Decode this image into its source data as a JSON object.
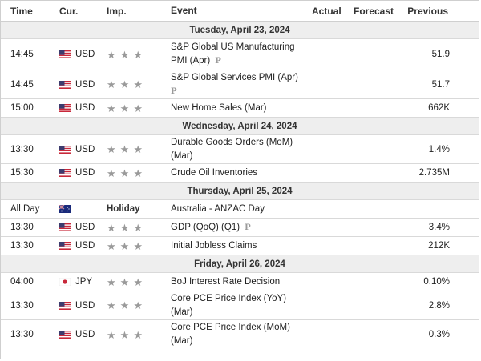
{
  "headers": {
    "time": "Time",
    "currency": "Cur.",
    "importance": "Imp.",
    "event": "Event",
    "actual": "Actual",
    "forecast": "Forecast",
    "previous": "Previous"
  },
  "dates": {
    "d0": "Tuesday, April 23, 2024",
    "d1": "Wednesday, April 24, 2024",
    "d2": "Thursday, April 25, 2024",
    "d3": "Friday, April 26, 2024"
  },
  "events": [
    {
      "time": "14:45",
      "currency": "USD",
      "flag": "us-flag",
      "stars": 3,
      "event": "S&P Global US Manufacturing PMI (Apr)",
      "preliminary": "P",
      "actual": "",
      "forecast": "",
      "previous": "51.9"
    },
    {
      "time": "14:45",
      "currency": "USD",
      "flag": "us-flag",
      "stars": 3,
      "event": "S&P Global Services PMI (Apr)",
      "preliminary": "P",
      "actual": "",
      "forecast": "",
      "previous": "51.7"
    },
    {
      "time": "15:00",
      "currency": "USD",
      "flag": "us-flag",
      "stars": 3,
      "event": "New Home Sales (Mar)",
      "actual": "",
      "forecast": "",
      "previous": "662K"
    },
    {
      "time": "13:30",
      "currency": "USD",
      "flag": "us-flag",
      "stars": 3,
      "event": "Durable Goods Orders (MoM) (Mar)",
      "actual": "",
      "forecast": "",
      "previous": "1.4%"
    },
    {
      "time": "15:30",
      "currency": "USD",
      "flag": "us-flag",
      "stars": 3,
      "event": "Crude Oil Inventories",
      "actual": "",
      "forecast": "",
      "previous": "2.735M"
    },
    {
      "time": "All Day",
      "currency": "",
      "flag": "australia-flag",
      "holiday": "Holiday",
      "event": "Australia - ANZAC Day",
      "actual": "",
      "forecast": "",
      "previous": ""
    },
    {
      "time": "13:30",
      "currency": "USD",
      "flag": "us-flag",
      "stars": 3,
      "event": "GDP (QoQ) (Q1)",
      "preliminary": "P",
      "actual": "",
      "forecast": "",
      "previous": "3.4%"
    },
    {
      "time": "13:30",
      "currency": "USD",
      "flag": "us-flag",
      "stars": 3,
      "event": "Initial Jobless Claims",
      "actual": "",
      "forecast": "",
      "previous": "212K"
    },
    {
      "time": "04:00",
      "currency": "JPY",
      "flag": "japan-flag",
      "stars": 3,
      "event": "BoJ Interest Rate Decision",
      "actual": "",
      "forecast": "",
      "previous": "0.10%"
    },
    {
      "time": "13:30",
      "currency": "USD",
      "flag": "us-flag",
      "stars": 3,
      "event": "Core PCE Price Index (YoY) (Mar)",
      "actual": "",
      "forecast": "",
      "previous": "2.8%"
    },
    {
      "time": "13:30",
      "currency": "USD",
      "flag": "us-flag",
      "stars": 3,
      "event": "Core PCE Price Index (MoM) (Mar)",
      "actual": "",
      "forecast": "",
      "previous": "0.3%"
    }
  ],
  "colors": {
    "date_band": "#eeeeee",
    "star_gray": "#9a9a9a",
    "border": "#d9d9d9"
  }
}
